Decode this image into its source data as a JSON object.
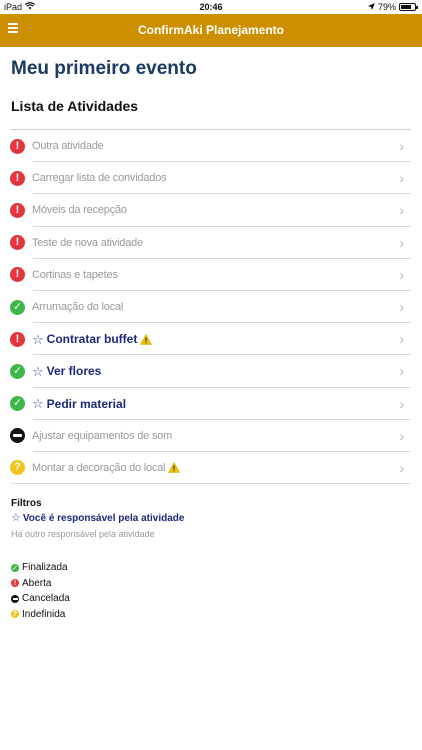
{
  "statusbar": {
    "device": "iPad",
    "time": "20:46",
    "battery": "79%",
    "battery_level": 0.79
  },
  "navbar": {
    "title": "ConfirmAki Planejamento",
    "menu_icon": "hamburger-menu-icon"
  },
  "page": {
    "title": "Meu primeiro evento",
    "section_title": "Lista de Atividades"
  },
  "activities": [
    {
      "label": "Outra atividade",
      "status": "open",
      "mine": false,
      "warning": false
    },
    {
      "label": "Carregar lista de convidados",
      "status": "open",
      "mine": false,
      "warning": false
    },
    {
      "label": "Móveis da recepção",
      "status": "open",
      "mine": false,
      "warning": false
    },
    {
      "label": "Teste de nova atividade",
      "status": "open",
      "mine": false,
      "warning": false
    },
    {
      "label": "Cortinas e tapetes",
      "status": "open",
      "mine": false,
      "warning": false
    },
    {
      "label": "Arrumação do local",
      "status": "done",
      "mine": false,
      "warning": false
    },
    {
      "label": "Contratar buffet",
      "status": "open",
      "mine": true,
      "warning": true
    },
    {
      "label": "Ver flores",
      "status": "done",
      "mine": true,
      "warning": false
    },
    {
      "label": "Pedir material",
      "status": "done",
      "mine": true,
      "warning": false
    },
    {
      "label": "Ajustar equipamentos de som",
      "status": "cancel",
      "mine": false,
      "warning": false
    },
    {
      "label": "Montar a decoração do local",
      "status": "unknown",
      "mine": false,
      "warning": true
    }
  ],
  "filters": {
    "title": "Filtros",
    "mine_label": "Você é responsável pela atividade",
    "other_label": "Há outro responsável pela atividade"
  },
  "legend": {
    "done": "Finalizada",
    "open": "Aberta",
    "cancel": "Cancelada",
    "unknown": "Indefinida"
  },
  "colors": {
    "navbar": "#cc8f00",
    "title": "#1c3a63",
    "mine_text": "#1b2a7a",
    "open": "#e3353a",
    "done": "#3db74a",
    "cancel": "#111111",
    "unknown": "#f0c419",
    "warning": "#f5c400"
  }
}
